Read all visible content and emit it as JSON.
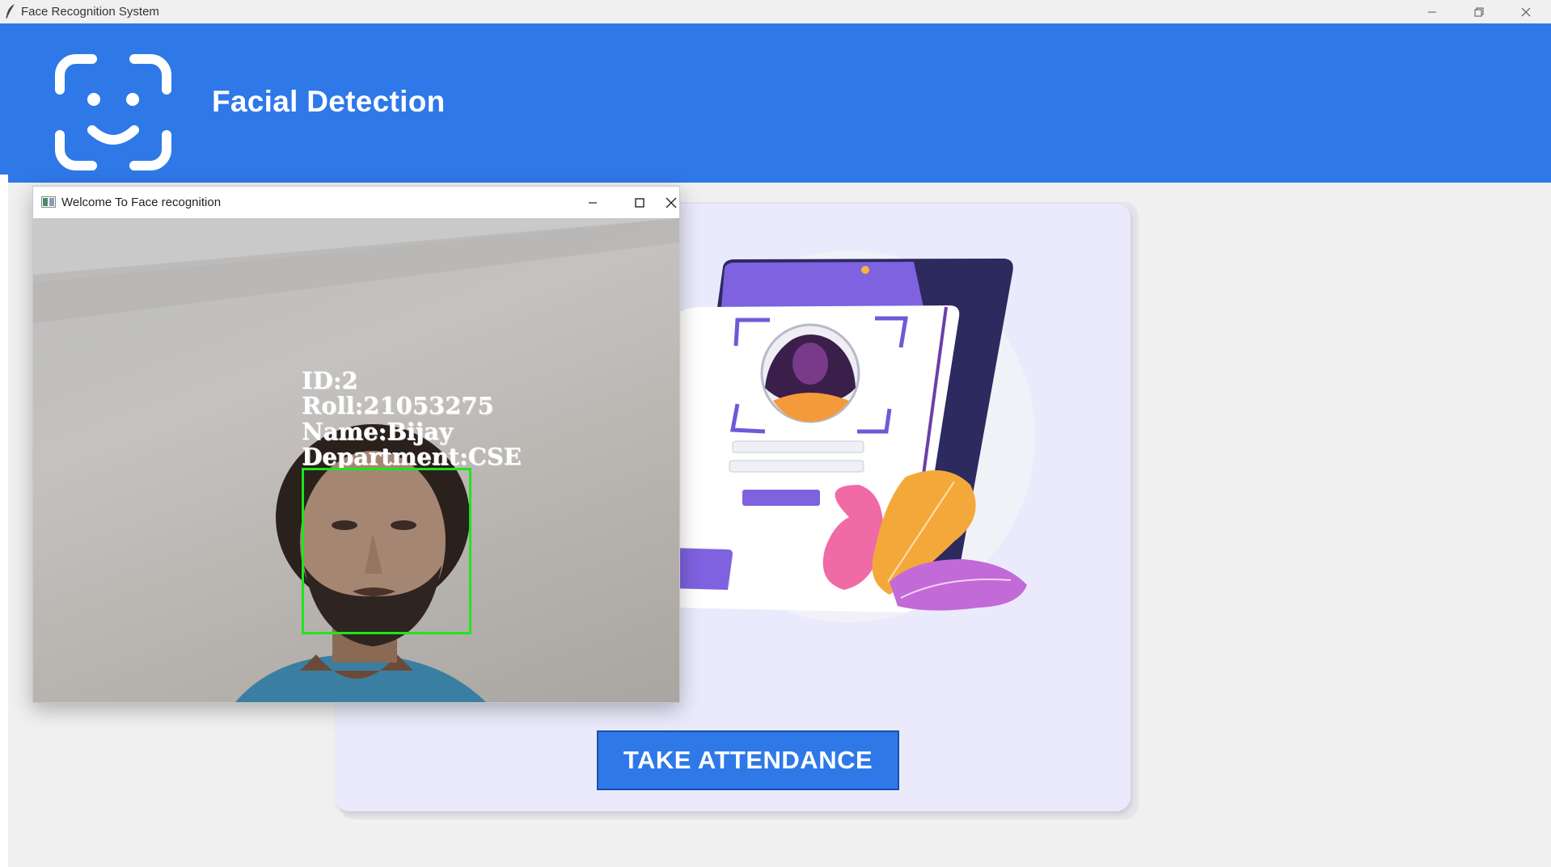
{
  "window": {
    "title": "Face Recognition System",
    "minimize_icon": "minimize-icon",
    "restore_icon": "restore-icon",
    "close_icon": "close-icon"
  },
  "header": {
    "logo_icon": "face-scan-icon",
    "title": "Facial Detection",
    "background": "#2f78e8"
  },
  "card": {
    "illustration": "profile-card-illustration",
    "button_label": "TAKE ATTENDANCE",
    "button_color": "#2f78e8"
  },
  "popup": {
    "title": "Welcome To Face recognition",
    "overlay": {
      "id": "ID:2",
      "roll": "Roll:21053275",
      "name": "Name:Bijay",
      "department": "Department:CSE"
    },
    "box_color": "#1ee61e"
  }
}
